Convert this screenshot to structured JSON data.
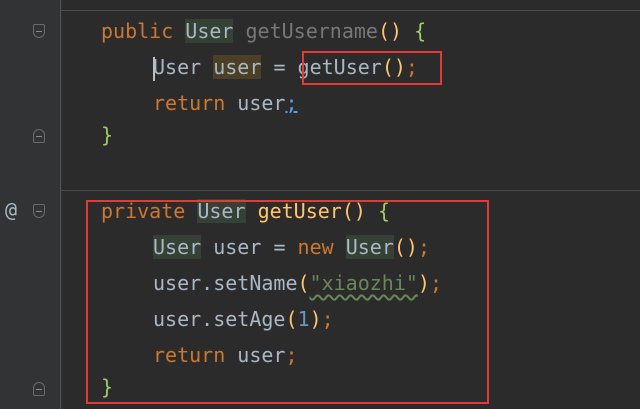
{
  "gutter": {
    "override_marker": "@"
  },
  "code": {
    "line1": {
      "kw_public": "public",
      "type_user": "User",
      "method_name": "getUsername",
      "paren_open": "(",
      "paren_close": ")",
      "brace_open": "{"
    },
    "line2": {
      "type_user": "User",
      "var_user": "user",
      "assign": "=",
      "call": "getUser",
      "parens": "()",
      "semicolon": ";"
    },
    "line3": {
      "kw_return": "return",
      "var_user": "user",
      "semicolon": ";"
    },
    "line4": {
      "brace_close": "}"
    },
    "line5": {
      "kw_private": "private",
      "type_user": "User",
      "method_name": "getUser",
      "paren_open": "(",
      "paren_close": ")",
      "brace_open": "{"
    },
    "line6": {
      "type_user": "User",
      "var_user": "user",
      "assign": "=",
      "kw_new": "new",
      "ctor": "User",
      "parens": "()",
      "semicolon": ";"
    },
    "line7": {
      "var_user": "user",
      "dot_method": ".setName",
      "paren_open": "(",
      "string": "\"xiaozhi\"",
      "paren_close": ")",
      "semicolon": ";"
    },
    "line8": {
      "var_user": "user",
      "dot_method": ".setAge",
      "paren_open": "(",
      "number": "1",
      "paren_close": ")",
      "semicolon": ";"
    },
    "line9": {
      "kw_return": "return",
      "var_user": "user",
      "semicolon": ";"
    },
    "line10": {
      "brace_close": "}"
    }
  },
  "colors": {
    "background": "#2b2b2b",
    "keyword": "#cc7832",
    "function": "#ffc66d",
    "string": "#6a8759",
    "number": "#6897bb",
    "highlight_box": "#e53935"
  }
}
